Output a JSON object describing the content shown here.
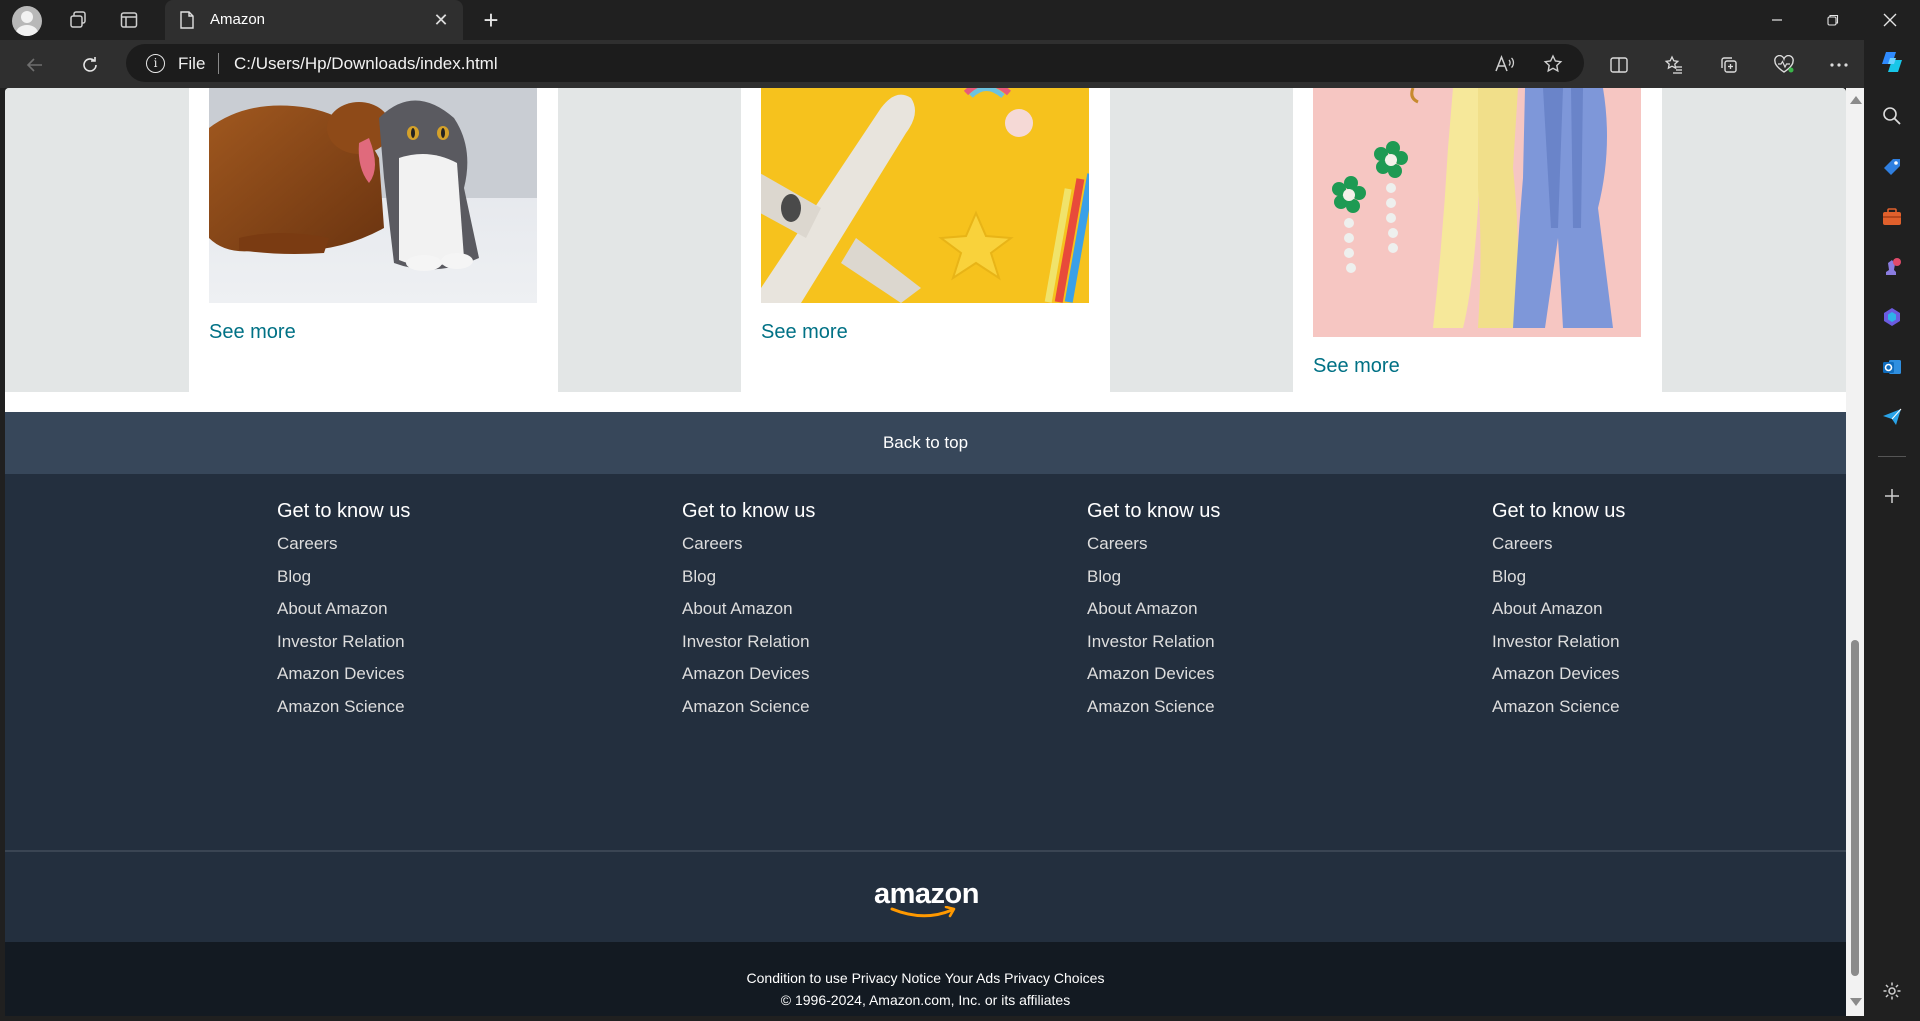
{
  "browser": {
    "tab_title": "Amazon",
    "address": {
      "scheme_label": "File",
      "url": "C:/Users/Hp/Downloads/index.html"
    }
  },
  "cards": [
    {
      "link": "See more"
    },
    {
      "link": "See more"
    },
    {
      "link": "See more"
    }
  ],
  "back_to_top": "Back to top",
  "footer": {
    "columns": [
      {
        "title": "Get to know us",
        "links": [
          "Careers",
          "Blog",
          "About Amazon",
          "Investor Relation",
          "Amazon Devices",
          "Amazon Science"
        ]
      },
      {
        "title": "Get to know us",
        "links": [
          "Careers",
          "Blog",
          "About Amazon",
          "Investor Relation",
          "Amazon Devices",
          "Amazon Science"
        ]
      },
      {
        "title": "Get to know us",
        "links": [
          "Careers",
          "Blog",
          "About Amazon",
          "Investor Relation",
          "Amazon Devices",
          "Amazon Science"
        ]
      },
      {
        "title": "Get to know us",
        "links": [
          "Careers",
          "Blog",
          "About Amazon",
          "Investor Relation",
          "Amazon Devices",
          "Amazon Science"
        ]
      }
    ],
    "logo_text": "amazon",
    "bottom_links": "Condition to use Privacy Notice Your Ads Privacy Choices",
    "copyright": "© 1996-2024, Amazon.com, Inc. or its affiliates"
  },
  "colors": {
    "link": "#007185",
    "back_to_top_bg": "#37475a",
    "footer_bg": "#232f3e",
    "bottom_bg": "#131a22",
    "logo_smile": "#ff9900"
  }
}
